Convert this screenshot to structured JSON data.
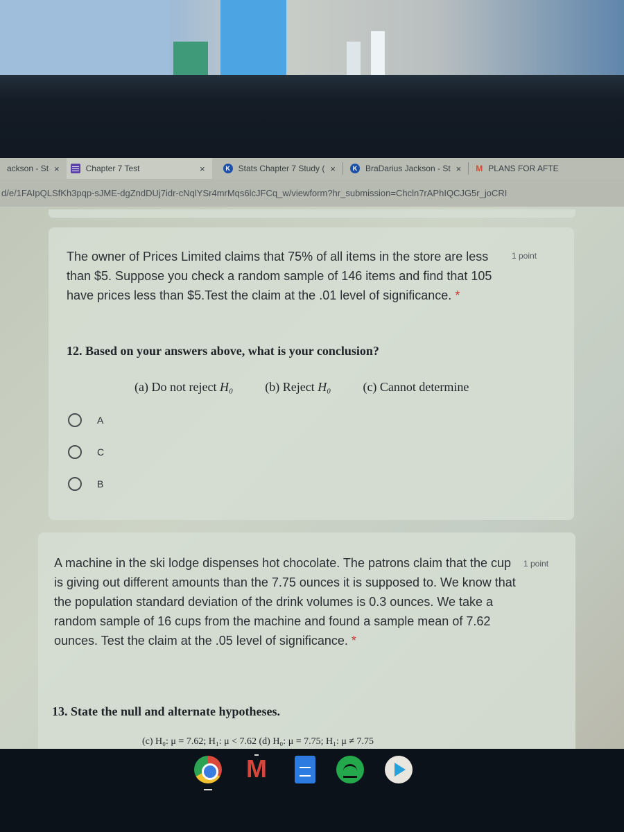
{
  "browser": {
    "tabs": [
      {
        "label": "ackson - St",
        "icon": "k-icon",
        "active": false
      },
      {
        "label": "Chapter 7 Test",
        "icon": "forms-icon",
        "active": true
      },
      {
        "label": "Stats Chapter 7 Study (",
        "icon": "k-icon",
        "active": false
      },
      {
        "label": "BraDarius Jackson - St",
        "icon": "k-icon",
        "active": false
      },
      {
        "label": "PLANS FOR AFTE",
        "icon": "gmail-icon",
        "active": false
      }
    ],
    "close_glyph": "×",
    "url": "d/e/1FAIpQLSfKh3pqp-sJME-dgZndDUj7idr-cNqlYSr4mrMqs6lcJFCq_w/viewform?hr_submission=Chcln7rAPhIQCJG5r_joCRI"
  },
  "questions": [
    {
      "text": "The owner of Prices Limited claims that 75% of all items in the store are less than $5. Suppose you check a random sample of 146 items and find that 105 have prices less than $5.Test the claim at the .01 level of significance.",
      "required_mark": "*",
      "points": "1 point",
      "sub_question": "12. Based on your answers above, what is your conclusion?",
      "choices_text": [
        {
          "prefix": "(a) Do not reject ",
          "h": "H₀"
        },
        {
          "prefix": "(b) Reject ",
          "h": "H₀"
        },
        {
          "prefix": "(c) Cannot determine",
          "h": ""
        }
      ],
      "options": [
        "A",
        "C",
        "B"
      ]
    },
    {
      "text": "A machine in the ski lodge dispenses hot chocolate. The patrons claim that the cup is giving out different amounts than the 7.75 ounces it is supposed to. We know that the population standard deviation of the drink volumes is 0.3 ounces. We take a random sample of 16 cups from the machine and found a sample mean of 7.62 ounces. Test the claim at the .05 level of significance.",
      "required_mark": "*",
      "points": "1 point",
      "sub_question": "13. State the null and alternate hypotheses.",
      "cut_choices": "(c) H₀: μ = 7.62; H₁: μ < 7.62        (d) H₀: μ = 7.75; H₁: μ ≠ 7.75"
    }
  ],
  "shelf": {
    "apps": [
      {
        "name": "Chrome",
        "running": true
      },
      {
        "name": "Gmail",
        "running": true
      },
      {
        "name": "Docs",
        "running": false
      },
      {
        "name": "Spotify",
        "running": false
      },
      {
        "name": "Play Store",
        "running": false
      }
    ]
  }
}
